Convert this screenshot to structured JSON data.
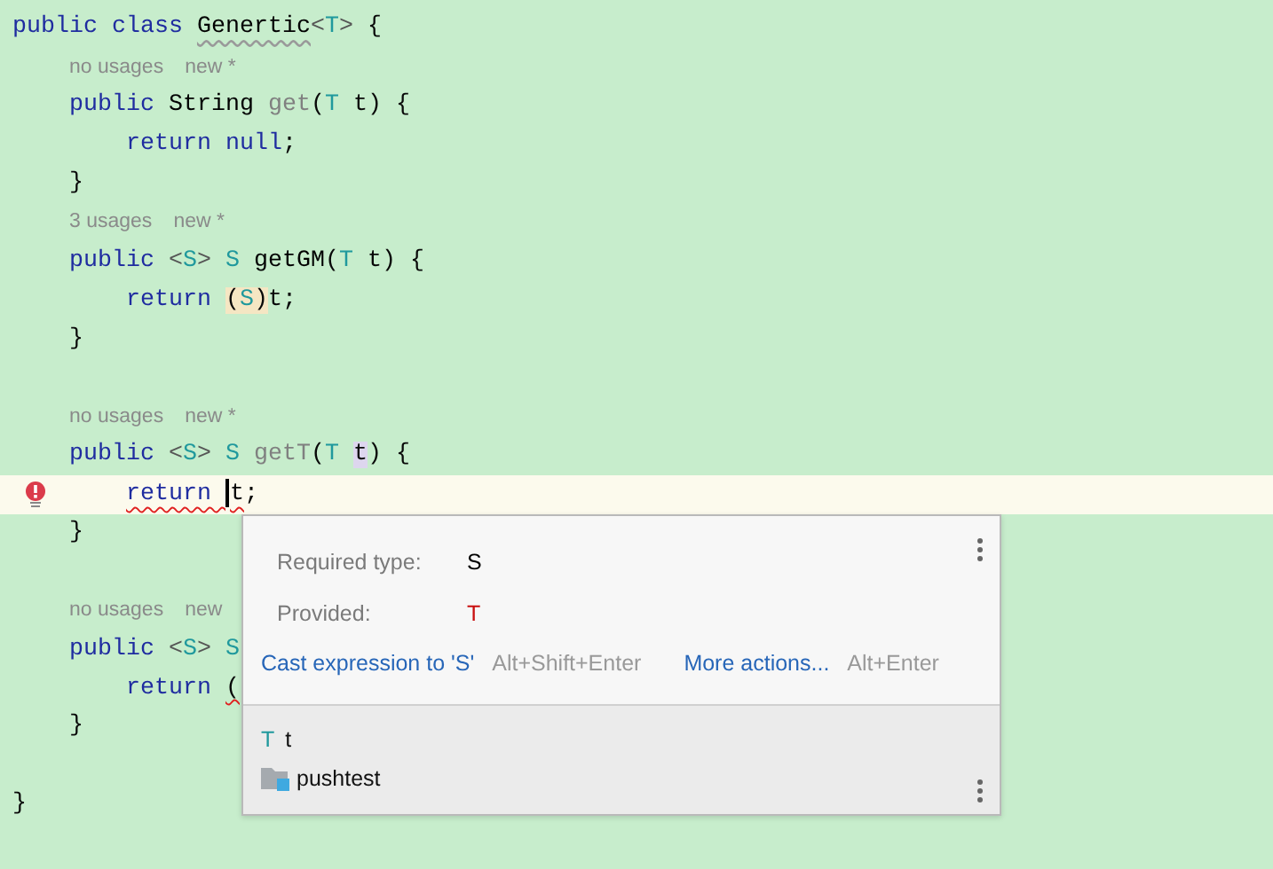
{
  "editor": {
    "lines": [
      {
        "kind": "code",
        "current": false,
        "error": false,
        "tokens": [
          {
            "kind": "kw",
            "text": "public class "
          },
          {
            "kind": "warn",
            "text": "Genertic"
          },
          {
            "kind": "punct",
            "text": "<"
          },
          {
            "kind": "tp",
            "text": "T"
          },
          {
            "kind": "punct",
            "text": ">"
          },
          {
            "kind": "p",
            "text": " {"
          }
        ]
      },
      {
        "kind": "hint",
        "usages": "no usages",
        "author": "new *"
      },
      {
        "kind": "code",
        "current": false,
        "error": false,
        "tokens": [
          {
            "kind": "kw",
            "text": "    public "
          },
          {
            "kind": "type",
            "text": "String "
          },
          {
            "kind": "unused",
            "text": "get"
          },
          {
            "kind": "p",
            "text": "("
          },
          {
            "kind": "tp",
            "text": "T"
          },
          {
            "kind": "p",
            "text": " t) {"
          }
        ]
      },
      {
        "kind": "code",
        "current": false,
        "error": false,
        "tokens": [
          {
            "kind": "kw",
            "text": "        return null"
          },
          {
            "kind": "p",
            "text": ";"
          }
        ]
      },
      {
        "kind": "code",
        "current": false,
        "error": false,
        "tokens": [
          {
            "kind": "p",
            "text": "    }"
          }
        ]
      },
      {
        "kind": "hint",
        "usages": "3 usages",
        "author": "new *"
      },
      {
        "kind": "code",
        "current": false,
        "error": false,
        "tokens": [
          {
            "kind": "kw",
            "text": "    public "
          },
          {
            "kind": "punct",
            "text": "<"
          },
          {
            "kind": "tp",
            "text": "S"
          },
          {
            "kind": "punct",
            "text": "> "
          },
          {
            "kind": "tp",
            "text": "S "
          },
          {
            "kind": "ident",
            "text": "getGM"
          },
          {
            "kind": "p",
            "text": "("
          },
          {
            "kind": "tp",
            "text": "T"
          },
          {
            "kind": "p",
            "text": " t) {"
          }
        ]
      },
      {
        "kind": "code",
        "current": false,
        "error": false,
        "tokens": [
          {
            "kind": "kw",
            "text": "        return "
          },
          {
            "kind": "cast-p",
            "text": "("
          },
          {
            "kind": "cast-tp",
            "text": "S"
          },
          {
            "kind": "cast-p",
            "text": ")"
          },
          {
            "kind": "p",
            "text": "t;"
          }
        ]
      },
      {
        "kind": "code",
        "current": false,
        "error": false,
        "tokens": [
          {
            "kind": "p",
            "text": "    }"
          }
        ]
      },
      {
        "kind": "blank"
      },
      {
        "kind": "hint",
        "usages": "no usages",
        "author": "new *"
      },
      {
        "kind": "code",
        "current": false,
        "error": false,
        "tokens": [
          {
            "kind": "kw",
            "text": "    public "
          },
          {
            "kind": "punct",
            "text": "<"
          },
          {
            "kind": "tp",
            "text": "S"
          },
          {
            "kind": "punct",
            "text": "> "
          },
          {
            "kind": "tp",
            "text": "S "
          },
          {
            "kind": "unused",
            "text": "getT"
          },
          {
            "kind": "p",
            "text": "("
          },
          {
            "kind": "tp",
            "text": "T "
          },
          {
            "kind": "usage-p",
            "text": "t"
          },
          {
            "kind": "p",
            "text": ") {"
          }
        ]
      },
      {
        "kind": "code",
        "current": true,
        "error": true,
        "tokens": [
          {
            "kind": "err-kw",
            "text": "        return "
          },
          {
            "kind": "caret"
          },
          {
            "kind": "err-p",
            "text": "t"
          },
          {
            "kind": "p",
            "text": ";"
          }
        ]
      },
      {
        "kind": "code",
        "current": false,
        "error": false,
        "tokens": [
          {
            "kind": "p",
            "text": "    }"
          }
        ]
      },
      {
        "kind": "blank"
      },
      {
        "kind": "hint",
        "usages": "no usages",
        "author": "new"
      },
      {
        "kind": "code",
        "current": false,
        "error": false,
        "tokens": [
          {
            "kind": "kw",
            "text": "    public "
          },
          {
            "kind": "punct",
            "text": "<"
          },
          {
            "kind": "tp",
            "text": "S"
          },
          {
            "kind": "punct",
            "text": "> "
          },
          {
            "kind": "tp",
            "text": "S"
          }
        ]
      },
      {
        "kind": "code",
        "current": false,
        "error": false,
        "tokens": [
          {
            "kind": "kw",
            "text": "        return "
          },
          {
            "kind": "err-p",
            "text": "("
          }
        ]
      },
      {
        "kind": "code",
        "current": false,
        "error": false,
        "tokens": [
          {
            "kind": "p",
            "text": "    }"
          }
        ]
      },
      {
        "kind": "blank"
      },
      {
        "kind": "code",
        "current": false,
        "error": false,
        "tokens": [
          {
            "kind": "p",
            "text": "}"
          }
        ]
      }
    ]
  },
  "popup": {
    "rows": [
      {
        "label": "Required type:",
        "value": "S",
        "kind": "expected"
      },
      {
        "label": "Provided:",
        "value": "T",
        "kind": "actual"
      }
    ],
    "actions": [
      {
        "label": "Cast expression to 'S'",
        "shortcut": "Alt+Shift+Enter"
      },
      {
        "label": "More actions...",
        "shortcut": "Alt+Enter"
      }
    ],
    "declaration": {
      "type": "T",
      "name": "t"
    },
    "location": "pushtest"
  }
}
